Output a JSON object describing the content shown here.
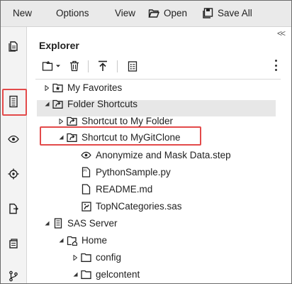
{
  "menu": {
    "new": "New",
    "options": "Options",
    "view": "View",
    "open": "Open",
    "save_all": "Save All"
  },
  "activity_bar": [
    {
      "name": "pages-icon"
    },
    {
      "name": "explorer-icon",
      "active": true
    },
    {
      "name": "eye-icon"
    },
    {
      "name": "target-icon"
    },
    {
      "name": "document-import-icon"
    },
    {
      "name": "database-icon"
    },
    {
      "name": "git-icon"
    }
  ],
  "panel": {
    "title": "Explorer",
    "collapse": "<<"
  },
  "tree": [
    {
      "label": "My Favorites",
      "icon": "folder-star-icon",
      "expanded": false
    },
    {
      "label": "Folder Shortcuts",
      "icon": "folder-shortcut-icon",
      "expanded": true
    },
    {
      "label": "Shortcut to My Folder",
      "icon": "folder-shortcut-icon",
      "expanded": false
    },
    {
      "label": "Shortcut to MyGitClone",
      "icon": "folder-shortcut-icon",
      "expanded": true,
      "selected": true
    },
    {
      "label": "Anonymize and Mask Data.step",
      "icon": "step-file-icon"
    },
    {
      "label": "PythonSample.py",
      "icon": "python-file-icon"
    },
    {
      "label": "README.md",
      "icon": "text-file-icon"
    },
    {
      "label": "TopNCategories.sas",
      "icon": "sas-file-icon"
    },
    {
      "label": "SAS Server",
      "icon": "server-icon",
      "expanded": true
    },
    {
      "label": "Home",
      "icon": "home-folder-icon",
      "expanded": true
    },
    {
      "label": "config",
      "icon": "folder-icon",
      "expanded": false
    },
    {
      "label": "gelcontent",
      "icon": "folder-icon",
      "expanded": true
    }
  ],
  "colors": {
    "highlight_outline": "#e34a4a",
    "selected_row": "#e7e7e7",
    "topbar": "#eaeaea"
  }
}
